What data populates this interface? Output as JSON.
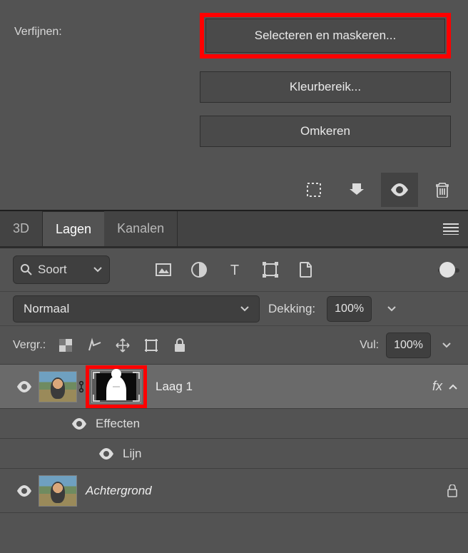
{
  "refine": {
    "label": "Verfijnen:",
    "buttons": {
      "select_and_mask": "Selecteren en maskeren...",
      "color_range": "Kleurbereik...",
      "invert": "Omkeren"
    }
  },
  "panel_tabs": {
    "tab_3d": "3D",
    "tab_layers": "Lagen",
    "tab_channels": "Kanalen"
  },
  "filter": {
    "search_label": "Soort"
  },
  "blend": {
    "mode": "Normaal",
    "opacity_label": "Dekking:",
    "opacity_value": "100%"
  },
  "lock": {
    "label": "Vergr.:",
    "fill_label": "Vul:",
    "fill_value": "100%"
  },
  "layers": {
    "layer1": {
      "name": "Laag 1",
      "fx": "fx",
      "effects_label": "Effecten",
      "line_label": "Lijn"
    },
    "background": {
      "name": "Achtergrond"
    }
  }
}
